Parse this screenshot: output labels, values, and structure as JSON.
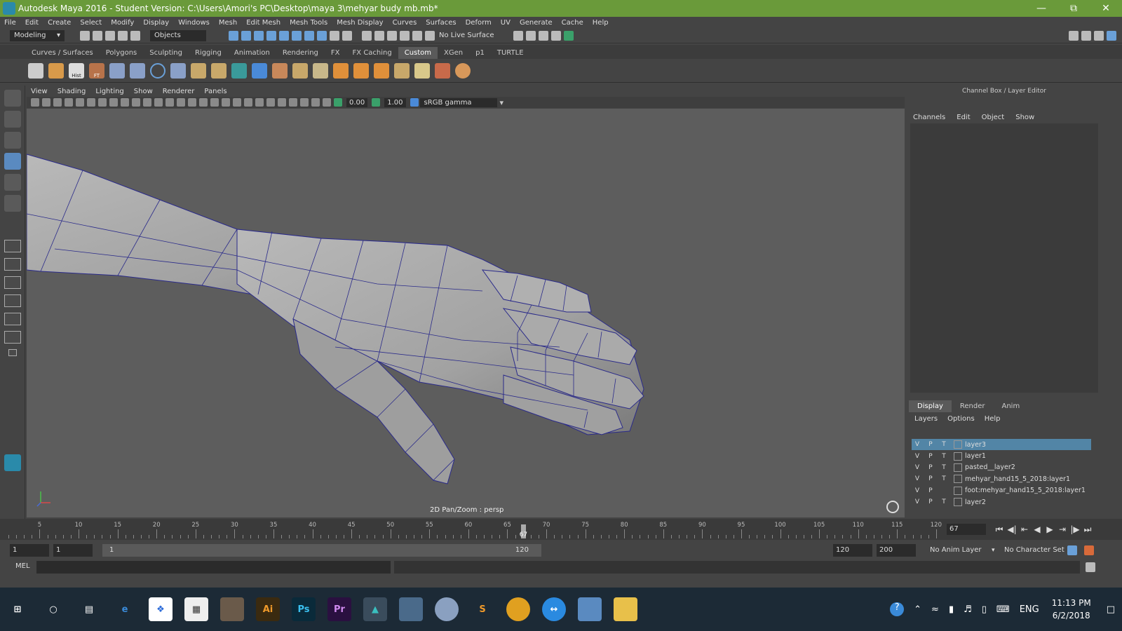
{
  "window": {
    "title": "Autodesk Maya 2016 - Student Version: C:\\Users\\Amori's PC\\Desktop\\maya 3\\mehyar budy mb.mb*"
  },
  "menubar": [
    "File",
    "Edit",
    "Create",
    "Select",
    "Modify",
    "Display",
    "Windows",
    "Mesh",
    "Edit Mesh",
    "Mesh Tools",
    "Mesh Display",
    "Curves",
    "Surfaces",
    "Deform",
    "UV",
    "Generate",
    "Cache",
    "Help"
  ],
  "statusline": {
    "menuset": "Modeling",
    "selection_mode": "Objects",
    "live_surface": "No Live Surface"
  },
  "shelf": {
    "tabs": [
      "Curves / Surfaces",
      "Polygons",
      "Sculpting",
      "Rigging",
      "Animation",
      "Rendering",
      "FX",
      "FX Caching",
      "Custom",
      "XGen",
      "p1",
      "TURTLE"
    ],
    "active_tab": "Custom",
    "icon_labels": {
      "hist": "Hist",
      "ft": "FT"
    }
  },
  "panel": {
    "menus": [
      "View",
      "Shading",
      "Lighting",
      "Show",
      "Renderer",
      "Panels"
    ],
    "exposure": "0.00",
    "gamma": "1.00",
    "color_space": "sRGB gamma",
    "status": "2D Pan/Zoom : persp"
  },
  "channelbox": {
    "title": "Channel Box / Layer Editor",
    "menus": [
      "Channels",
      "Edit",
      "Object",
      "Show"
    ]
  },
  "layer_editor": {
    "tabs": [
      "Display",
      "Render",
      "Anim"
    ],
    "active_tab": "Display",
    "menus": [
      "Layers",
      "Options",
      "Help"
    ],
    "layers": [
      {
        "v": "V",
        "p": "P",
        "t": "T",
        "name": "layer3",
        "selected": true
      },
      {
        "v": "V",
        "p": "P",
        "t": "T",
        "name": "layer1",
        "selected": false
      },
      {
        "v": "V",
        "p": "P",
        "t": "T",
        "name": "pasted__layer2",
        "selected": false
      },
      {
        "v": "V",
        "p": "P",
        "t": "T",
        "name": "mehyar_hand15_5_2018:layer1",
        "selected": false
      },
      {
        "v": "V",
        "p": "P",
        "t": "",
        "name": "foot:mehyar_hand15_5_2018:layer1",
        "selected": false
      },
      {
        "v": "V",
        "p": "P",
        "t": "T",
        "name": "layer2",
        "selected": false
      }
    ]
  },
  "timeslider": {
    "ticks": [
      5,
      10,
      15,
      20,
      25,
      30,
      35,
      40,
      45,
      50,
      55,
      60,
      65,
      70,
      75,
      80,
      85,
      90,
      95,
      100,
      105,
      110,
      115,
      120
    ],
    "range_min": 1,
    "range_max": 121,
    "current_frame": 67,
    "current_frame_label": "67",
    "current_frame_field": "67"
  },
  "rangeslider": {
    "start_field": "1",
    "playback_start": "1",
    "range_start_label": "1",
    "range_end_label": "120",
    "playback_end": "120",
    "end_field": "200",
    "anim_layer": "No Anim Layer",
    "character_set": "No Character Set"
  },
  "cmdline": {
    "label": "MEL"
  },
  "taskbar": {
    "apps": [
      "start",
      "search",
      "task-view",
      "edge",
      "dropbox",
      "calculator",
      "app-game",
      "illustrator",
      "photoshop",
      "premiere",
      "maya",
      "app-tool",
      "app-globe",
      "sublime",
      "chrome",
      "teamviewer",
      "app-user",
      "file-explorer"
    ],
    "labels": {
      "illustrator": "Ai",
      "photoshop": "Ps",
      "premiere": "Pr"
    },
    "lang": "ENG",
    "time": "11:13 PM",
    "date": "6/2/2018"
  }
}
